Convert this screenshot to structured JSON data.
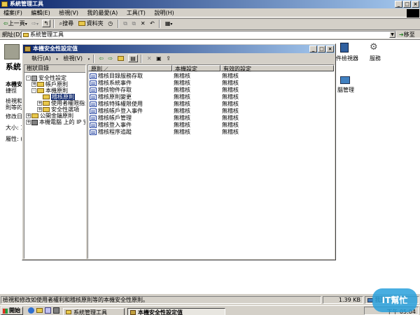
{
  "main_window": {
    "title": "系統管理工具",
    "menu": [
      "檔案(F)",
      "編輯(E)",
      "檢視(V)",
      "我的最愛(A)",
      "工具(T)",
      "說明(H)"
    ],
    "toolbar": {
      "back": "上一頁",
      "search": "搜尋",
      "folders": "資料夾"
    },
    "address_label": "網址(D)",
    "address_value": "系統管理工具",
    "go_label": "移至",
    "side_panel": {
      "title": "系統",
      "heading": "本機安",
      "subheading": "捷徑",
      "desc1": "檢視和",
      "desc2": "則等的",
      "modified": "修改日",
      "size": "大小: 1",
      "attributes": "屬性: (-"
    },
    "right_icons": [
      {
        "label": "件檢視器"
      },
      {
        "label": "服務"
      },
      {
        "label": "腦管理"
      }
    ],
    "status_text": "檢視和修改如使用者權利和稽核原則等的本機安全性原則。",
    "status_size": "1.39 KB",
    "status_zone": "我的"
  },
  "policy_window": {
    "title": "本機安全性設定值",
    "menu": [
      "執行(A)",
      "檢視(V)"
    ],
    "tree_tab": "樹狀目錄",
    "tree": [
      {
        "label": "安全性設定",
        "level": 0,
        "expander": "-"
      },
      {
        "label": "帳戶原則",
        "level": 1,
        "expander": "+"
      },
      {
        "label": "本機原則",
        "level": 1,
        "expander": "-"
      },
      {
        "label": "稽核原則",
        "level": 2,
        "expander": "",
        "selected": true
      },
      {
        "label": "使用者權限指派",
        "level": 2,
        "expander": "+"
      },
      {
        "label": "安全性選項",
        "level": 2,
        "expander": "+"
      },
      {
        "label": "公開金鑰原則",
        "level": 1,
        "expander": "+"
      },
      {
        "label": "本機電腦 上的 IP 安",
        "level": 1,
        "expander": "+"
      }
    ],
    "columns": [
      "原則",
      "本機設定",
      "有效的設定"
    ],
    "rows": [
      [
        "稽核目錄服務存取",
        "無稽核",
        "無稽核"
      ],
      [
        "稽核系統事件",
        "無稽核",
        "無稽核"
      ],
      [
        "稽核物件存取",
        "無稽核",
        "無稽核"
      ],
      [
        "稽核原則變更",
        "無稽核",
        "無稽核"
      ],
      [
        "稽核特殊權限使用",
        "無稽核",
        "無稽核"
      ],
      [
        "稽核帳戶登入事件",
        "無稽核",
        "無稽核"
      ],
      [
        "稽核帳戶管理",
        "無稽核",
        "無稽核"
      ],
      [
        "稽核登入事件",
        "無稽核",
        "無稽核"
      ],
      [
        "稽核程序追蹤",
        "無稽核",
        "無稽核"
      ]
    ]
  },
  "taskbar": {
    "start": "開始",
    "tasks": [
      "系統管理工具",
      "本機安全性設定值"
    ],
    "clock": "下午 05:04"
  },
  "watermark": "IT幫忙"
}
